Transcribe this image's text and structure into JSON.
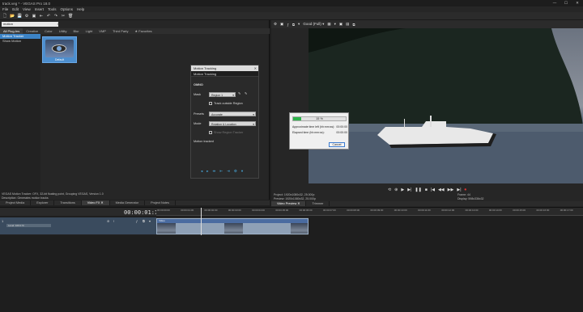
{
  "window": {
    "title": "track.veg * - VEGAS Pro 18.0",
    "controls": [
      "—",
      "☐",
      "✕"
    ]
  },
  "menu": [
    "File",
    "Edit",
    "View",
    "Insert",
    "Tools",
    "Options",
    "Help"
  ],
  "toolbar": [
    "🗋",
    "📂",
    "💾",
    "⚙",
    "▣",
    "⇤",
    "↶",
    "↷",
    "✂",
    "🗑"
  ],
  "fx": {
    "search_value": "motion",
    "tabs": [
      "All Plug-Ins",
      "Creative",
      "Color",
      "Utility",
      "Blur",
      "Light",
      "VMP",
      "Third Party",
      "★ Favorites"
    ],
    "tree": [
      "Motion Tracker",
      "Show Motion"
    ],
    "thumb_label": "Default"
  },
  "motion_dialog": {
    "title": "Motion Tracking",
    "subtitle": "Motion Tracking",
    "section": "OMNO",
    "mask_label": "Mask",
    "mask_value": "Region 1",
    "track_label": "Track outside Region",
    "presets_label": "Presets",
    "presets_value": "Accurate",
    "mode_label": "Mode",
    "mode_value": "Rotation & Location",
    "show_label": "Show Region Tracker",
    "motion_label": "Motion tracked"
  },
  "fx_info": {
    "line1": "VEGAS Motion Tracker: OFX, 32-bit floating point, Grouping VEGAS, Version 1.0",
    "line2": "Description: Generates motion tracks"
  },
  "dock_tabs": [
    "Project Media",
    "Explorer",
    "Transitions",
    "Video FX ✕",
    "Media Generator",
    "Project Notes"
  ],
  "preview": {
    "toolbar": [
      "⚙",
      "▣",
      "ƒ",
      "⧉",
      "▾",
      "Good (Full) ▾",
      "▦",
      "▾",
      "▣",
      "▤",
      "⧉"
    ],
    "progress": {
      "percent": 0.15,
      "percent_label": "15 %",
      "rows": [
        {
          "label": "Approximate time left (hh:mm:ss):",
          "value": "00:00:00"
        },
        {
          "label": "Elapsed time (hh:mm:ss):",
          "value": "00:00:00"
        }
      ],
      "cancel": "Cancel"
    },
    "transport": [
      "⟲",
      "⊕",
      "▶",
      "▶|",
      "❚❚",
      "■",
      "|◀",
      "◀◀",
      "▶▶",
      "▶|",
      "⏺"
    ],
    "info_left": [
      "Project: 1920x1080x32, 25.000p",
      "Preview: 1920x1080x32, 25.000p",
      "Display: 598x336x32"
    ],
    "info_right": [
      "Frame: 44",
      "Display: 598x336x32"
    ],
    "tabs": [
      "Video Preview ✕",
      "Trimmer"
    ]
  },
  "timeline": {
    "timecode": "00:00:01:19",
    "ruler": [
      "00:00:00:00",
      "00:00:01:00",
      "00:00:02:00",
      "00:00:03:00",
      "00:00:04:00",
      "00:00:05:00",
      "00:00:06:00",
      "00:00:07:00",
      "00:00:08:00",
      "00:00:09:00",
      "00:00:10:00",
      "00:00:11:00",
      "00:00:12:00",
      "00:00:13:00",
      "00:00:14:00",
      "00:00:15:00",
      "00:00:16:00",
      "00:00:17:00"
    ],
    "track_name": "Level: 100.0 %",
    "clip_label": "Video"
  }
}
